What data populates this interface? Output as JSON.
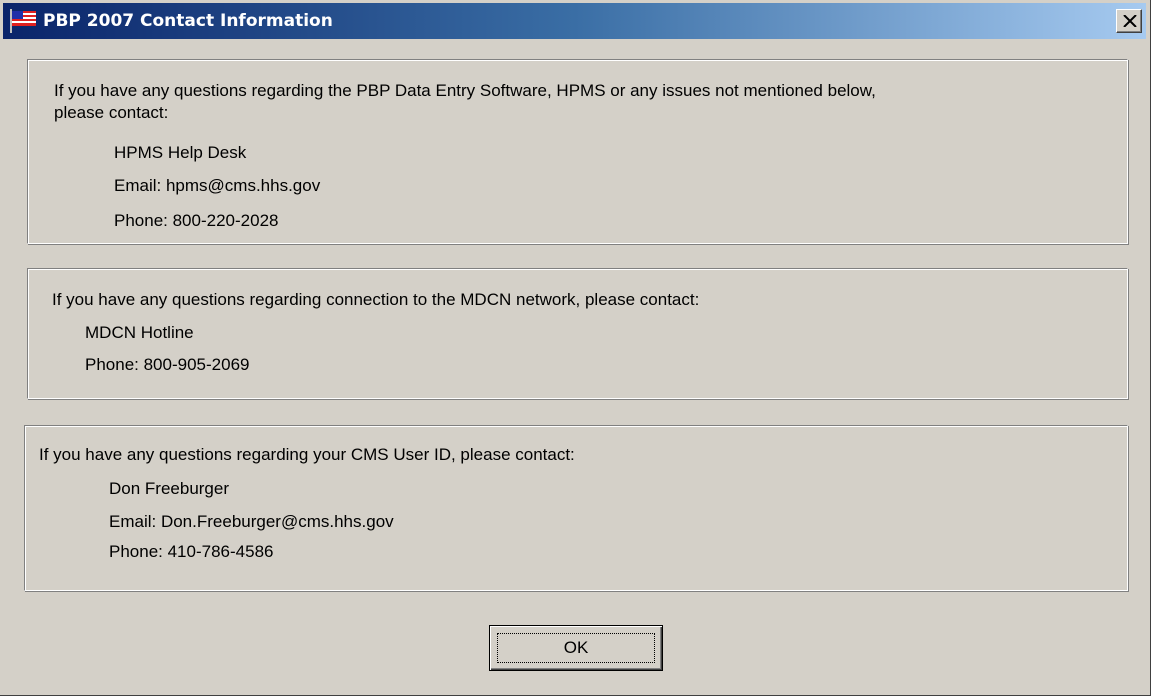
{
  "window": {
    "title": "PBP 2007 Contact Information",
    "icon": "us-flag-icon",
    "close_label": "×"
  },
  "sections": [
    {
      "intro_lines": [
        "If you have any questions regarding the PBP Data Entry Software, HPMS or any issues not mentioned below,",
        "please contact:"
      ],
      "contact_name": "HPMS Help Desk",
      "email": "Email:  hpms@cms.hhs.gov",
      "phone": "Phone:  800-220-2028"
    },
    {
      "intro_lines": [
        "If you have any questions regarding connection to the MDCN network, please contact:"
      ],
      "contact_name": "MDCN Hotline",
      "phone": "Phone:  800-905-2069"
    },
    {
      "intro_lines": [
        "If you have any questions regarding your CMS User ID, please contact:"
      ],
      "contact_name": "Don Freeburger",
      "email": "Email:  Don.Freeburger@cms.hhs.gov",
      "phone": "Phone:  410-786-4586"
    }
  ],
  "buttons": {
    "ok_label": "OK"
  },
  "colors": {
    "dialog_bg": "#d4d0c8",
    "titlebar_start": "#0a246a",
    "titlebar_end": "#a6caf0",
    "title_text": "#ffffff"
  }
}
